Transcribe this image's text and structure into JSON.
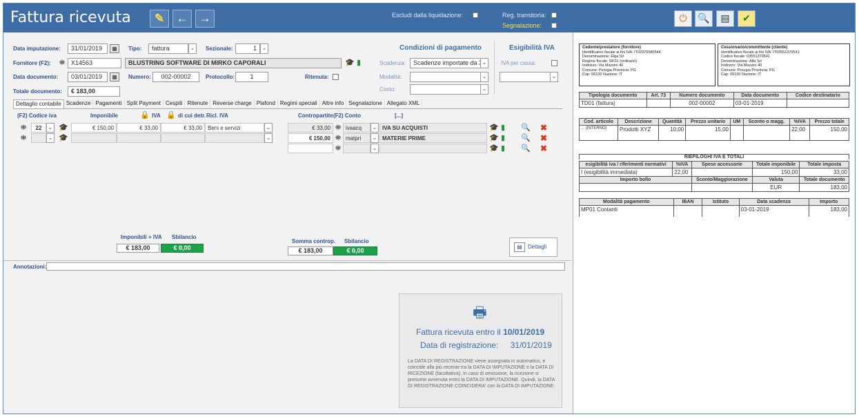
{
  "title": "Fattura ricevuta",
  "header": {
    "escludi_label": "Escludi dalla liquidazione:",
    "reg_transitoria_label": "Reg. transitoria:",
    "segnalazione_label": "Segnalazione:"
  },
  "form": {
    "data_imputazione_label": "Data imputazione:",
    "data_imputazione": "31/01/2019",
    "tipo_label": "Tipo:",
    "tipo": "fattura",
    "sezionale_label": "Sezionale:",
    "sezionale": "1",
    "fornitore_label": "Fornitore (F2):",
    "fornitore_code": "X14563",
    "fornitore_name": "BLUSTRING SOFTWARE DI MIRKO CAPORALI",
    "data_documento_label": "Data documento:",
    "data_documento": "03/01/2019",
    "numero_label": "Numero:",
    "numero": "002-00002",
    "protocollo_label": "Protocollo:",
    "protocollo": "1",
    "ritenuta_label": "Ritenuta:",
    "totale_label": "Totale documento:",
    "totale": "€ 183,00"
  },
  "condizioni": {
    "title": "Condizioni di pagamento",
    "scadenza_label": "Scadenza:",
    "scadenza": "Scadenze importate da XML",
    "modalita_label": "Modalità:",
    "conto_label": "Conto:"
  },
  "esigibilita": {
    "title": "Esigibilità IVA",
    "iva_cassa_label": "IVA per cassa:"
  },
  "tabs": [
    "Dettaglio contabile",
    "Scadenze",
    "Pagamenti",
    "Split Payment",
    "Cespiti",
    "Ritenute",
    "Reverse charge",
    "Plafond",
    "Regimi speciali",
    "Altre info",
    "Segnalazione",
    "Allegato XML"
  ],
  "grid": {
    "headers": {
      "codice_iva": "(F2) Codice iva",
      "imponibile": "Imponibile",
      "iva": "IVA",
      "di_cui_detr": "di cui detr.",
      "ricl_iva": "Ricl. IVA",
      "contropartite": "Contropartite",
      "conto": "(F2) Conto",
      "extra": "[...]"
    },
    "rows": [
      {
        "code": "22",
        "imponibile": "€ 150,00",
        "iva": "€ 33,00",
        "detr": "€ 33,00",
        "ricl": "Beni e servizi"
      },
      {
        "code": "",
        "imponibile": "",
        "iva": "",
        "detr": "",
        "ricl": ""
      }
    ],
    "contro_rows": [
      {
        "importo": "€ 33,00",
        "conto": "ivaacq",
        "desc": "IVA SU ACQUISTI"
      },
      {
        "importo": "€ 150,00",
        "conto": "matpri",
        "desc": "MATERIE PRIME"
      },
      {
        "importo": "",
        "conto": "",
        "desc": ""
      }
    ]
  },
  "totals": {
    "imponibili_iva_label": "Imponibili + IVA",
    "imponibili_iva": "€ 183,00",
    "sbilancio_label": "Sbilancio",
    "sbilancio": "€ 0,00",
    "somma_label": "Somma controp.",
    "somma": "€ 183,00",
    "sbilancio2": "€ 0,00",
    "dettagli": "Dettagli"
  },
  "annotazioni_label": "Annotazioni:",
  "info": {
    "line1_prefix": "Fattura ricevuta entro il",
    "line1_date": "10/01/2019",
    "line2_prefix": "Data di registrazione:",
    "line2_date": "31/01/2019",
    "note": "La DATA DI REGISTRAZIONE viene assegnata in automatico, e coincide alla più recente tra la DATA DI IMPUTAZIONE e la DATA DI RICEZIONE (facoltativa). In caso di omissione, la ricezione si presume avvenuta entro la DATA DI IMPUTAZIONE. Quindi, la DATA DI REGISTRAZIONE COINCIDERA' con la DATA DI IMPUTAZIONE."
  },
  "doc": {
    "cedente": {
      "title": "Cedente/prestatore (fornitore)",
      "lines": [
        "Identificativo fiscale ai fini IVA: IT02976580544",
        "Denominazione: Elga Srl",
        "Regime fiscale: RF01 (ordinario)",
        "Indirizzo: Via Mazzini 40",
        "Comune: Perugia Provincia: PG",
        "Cap: 06100 Nazione: IT"
      ]
    },
    "cessionario": {
      "title": "Cessionario/committente (cliente)",
      "lines": [
        "Identificativo fiscale ai fini IVA: IT03551370541",
        "Codice fiscale: 03551370541",
        "Denominazione: Alfa Srl",
        "Indirizzo: Via Mazzini 40",
        "Comune: Perugia Provincia: PG",
        "Cap: 06100 Nazione: IT"
      ]
    },
    "tipologia_headers": [
      "Tipologia documento",
      "Art. 73",
      "Numero documento",
      "Data documento",
      "Codice destinatario"
    ],
    "tipologia_row": [
      "TD01 (fattura)",
      "",
      "002-00002",
      "03-01-2019",
      ""
    ],
    "dettaglio_headers": [
      "Cod. articolo",
      "Descrizione",
      "Quantità",
      "Prezzo unitario",
      "UM",
      "Sconto o magg.",
      "%IVA",
      "Prezzo totale"
    ],
    "dettaglio_row": [
      "... (INTERNO)",
      "Prodotti XYZ",
      "10,00",
      "15,00",
      "",
      "",
      "22,00",
      "150,00"
    ],
    "riepilogo_title": "RIEPILOGHI IVA E TOTALI",
    "riepilogo_headers": [
      "esigibilità iva / riferimenti normativi",
      "%IVA",
      "Spese accessorie",
      "Totale imponibile",
      "Totale imposta"
    ],
    "riepilogo_row": [
      "I (esigibilità immediata)",
      "22,00",
      "",
      "150,00",
      "33,00"
    ],
    "bollo_headers": [
      "Importo bollo",
      "Sconto/Maggiorazione",
      "Valuta",
      "Totale documento"
    ],
    "bollo_row": [
      "",
      "",
      "EUR",
      "183,00"
    ],
    "pagamento_headers": [
      "Modalità pagamento",
      "IBAN",
      "Istituto",
      "Data scadenza",
      "Importo"
    ],
    "pagamento_row": [
      "MP01 Contanti",
      "",
      "",
      "03-01-2019",
      "183,00"
    ]
  },
  "colors": {
    "accent": "#3e6da5",
    "green": "#1fa04a",
    "red": "#d43a1a"
  }
}
